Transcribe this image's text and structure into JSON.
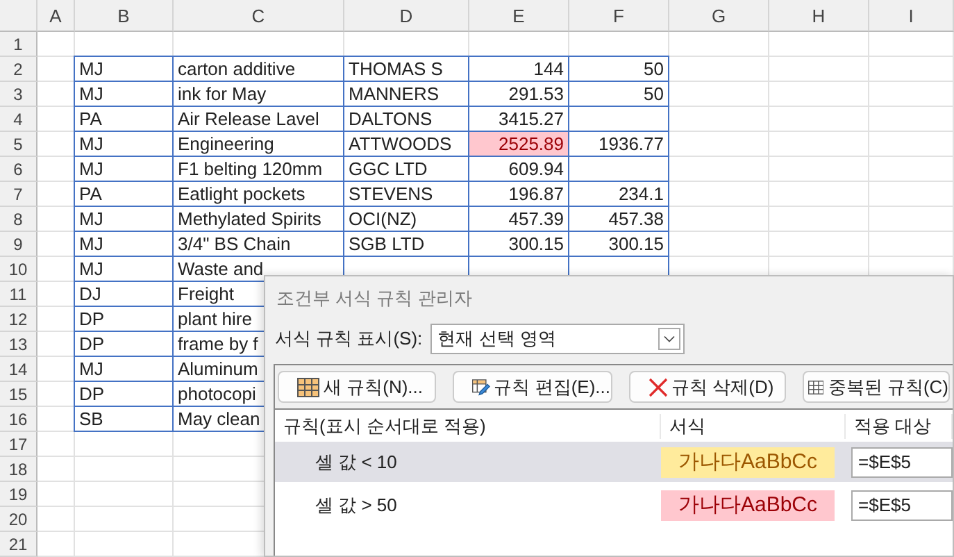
{
  "sheet": {
    "columns": [
      "A",
      "B",
      "C",
      "D",
      "E",
      "F",
      "G",
      "H",
      "I"
    ],
    "rows": [
      {
        "number": "1"
      },
      {
        "number": "2",
        "b": "MJ",
        "c": "carton additive",
        "d": "THOMAS S",
        "e": "144",
        "e_highlighted": false,
        "f": "50"
      },
      {
        "number": "3",
        "b": "MJ",
        "c": "ink for May",
        "d": "MANNERS",
        "e": "291.53",
        "e_highlighted": false,
        "f": "50"
      },
      {
        "number": "4",
        "b": "PA",
        "c": "Air Release Lavel",
        "d": "DALTONS",
        "e": "3415.27",
        "e_highlighted": false
      },
      {
        "number": "5",
        "b": "MJ",
        "c": "Engineering",
        "d": "ATTWOODS",
        "e": "2525.89",
        "e_highlighted": true,
        "f": "1936.77"
      },
      {
        "number": "6",
        "b": "MJ",
        "c": "F1 belting 120mm",
        "d": "GGC LTD",
        "e": "609.94",
        "e_highlighted": false
      },
      {
        "number": "7",
        "b": "PA",
        "c": "Eatlight pockets",
        "d": "STEVENS",
        "e": "196.87",
        "e_highlighted": false,
        "f": "234.1"
      },
      {
        "number": "8",
        "b": "MJ",
        "c": "Methylated Spirits",
        "d": "OCI(NZ)",
        "e": "457.39",
        "e_highlighted": false,
        "f": "457.38"
      },
      {
        "number": "9",
        "b": "MJ",
        "c": "3/4\" BS Chain",
        "d": "SGB LTD",
        "e": "300.15",
        "e_highlighted": false,
        "f": "300.15"
      },
      {
        "number": "10",
        "b": "MJ",
        "c": "Waste and"
      },
      {
        "number": "11",
        "b": "DJ",
        "c": "Freight"
      },
      {
        "number": "12",
        "b": "DP",
        "c": "plant hire"
      },
      {
        "number": "13",
        "b": "DP",
        "c": "frame by f"
      },
      {
        "number": "14",
        "b": "MJ",
        "c": "Aluminum"
      },
      {
        "number": "15",
        "b": "DP",
        "c": "photocopi"
      },
      {
        "number": "16",
        "b": "SB",
        "c": "May clean"
      },
      {
        "number": "17"
      },
      {
        "number": "18"
      },
      {
        "number": "19"
      },
      {
        "number": "20"
      },
      {
        "number": "21"
      }
    ]
  },
  "dialog": {
    "title": "조건부 서식 규칙 관리자",
    "show_label": "서식 규칙 표시(S):",
    "show_value": "현재 선택 영역",
    "buttons": [
      {
        "kind": "new",
        "label": "새 규칙(N)..."
      },
      {
        "kind": "edit",
        "label": "규칙 편집(E)..."
      },
      {
        "kind": "delete",
        "label": "규칙 삭제(D)"
      },
      {
        "kind": "duplicate",
        "label": "중복된 규칙(C)"
      }
    ],
    "columns": [
      "규칙(표시 순서대로 적용)",
      "서식",
      "적용 대상"
    ],
    "rules": [
      {
        "rule": "셀 값 < 10",
        "preview": "가나다AaBbCc",
        "color": "#ffeb9c",
        "applies_to": "=$E$5",
        "selected": true
      },
      {
        "rule": "셀 값 > 50",
        "preview": "가나다AaBbCc",
        "color": "#ffc7ce",
        "applies_to": "=$E$5",
        "selected": false
      }
    ]
  }
}
